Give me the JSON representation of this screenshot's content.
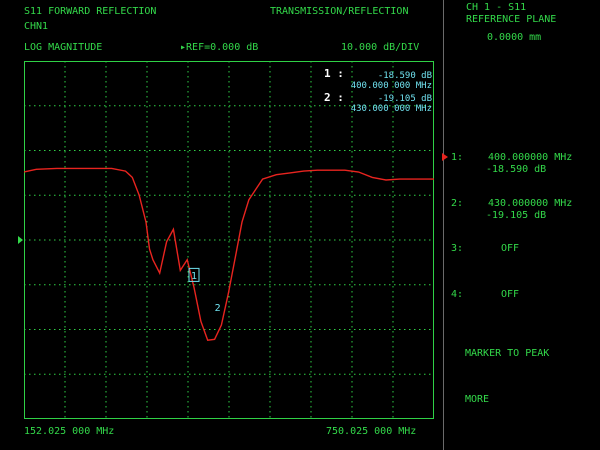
{
  "header": {
    "measurement": "S11 FORWARD REFLECTION",
    "mode": "TRANSMISSION/REFLECTION",
    "channel": "CHN1",
    "format": "LOG MAGNITUDE",
    "reference_marker": "▸",
    "reference": "REF=0.000 dB",
    "scale": "10.000 dB/DIV"
  },
  "footer": {
    "start_freq": "152.025 000 MHz",
    "stop_freq": "750.025 000 MHz"
  },
  "marker_readout": [
    {
      "num": "1 :",
      "value": "-18.590 dB",
      "freq": "400.000 000 MHz"
    },
    {
      "num": "2 :",
      "value": "-19.105 dB",
      "freq": "430.000 000 MHz"
    }
  ],
  "plot_markers": [
    {
      "label": "1",
      "active": true
    },
    {
      "label": "2",
      "active": false
    }
  ],
  "softkeys": {
    "title_line1": "CH 1 - S11",
    "title_line2": "REFERENCE PLANE",
    "title_line3": "0.0000 mm",
    "markers": [
      {
        "num": "1:",
        "freq": "400.000000 MHz",
        "value": "-18.590 dB"
      },
      {
        "num": "2:",
        "freq": "430.000000 MHz",
        "value": "-19.105 dB"
      },
      {
        "num": "3:",
        "state": "OFF"
      },
      {
        "num": "4:",
        "state": "OFF"
      }
    ],
    "marker_to_peak": "MARKER TO PEAK",
    "more": "MORE"
  },
  "colors": {
    "text": "#33d94a",
    "readout": "#6fe0ee",
    "grid": "#2fd146",
    "trace": "#e8241f",
    "active_arrow": "#e8241f"
  },
  "chart_data": {
    "type": "line",
    "title": "S11 FORWARD REFLECTION",
    "x_unit": "MHz",
    "y_unit": "dB",
    "xlim": [
      152.025,
      750.025
    ],
    "ylim": [
      -28,
      12
    ],
    "grid": true,
    "x_divisions": 10,
    "y_divisions": 8,
    "series": [
      {
        "x": [
          152.025,
          170,
          200,
          230,
          260,
          280,
          300,
          310,
          320,
          330,
          335,
          340,
          350,
          360,
          370,
          380,
          390,
          400,
          410,
          420,
          430,
          440,
          450,
          460,
          470,
          480,
          500,
          520,
          540,
          560,
          580,
          600,
          620,
          640,
          660,
          680,
          700,
          720,
          750.025
        ],
        "y": [
          -0.4,
          -0.1,
          0,
          0,
          0,
          0,
          -0.3,
          -1,
          -3,
          -6,
          -9,
          -10.2,
          -11.7,
          -8.2,
          -6.8,
          -11.4,
          -10.2,
          -13.3,
          -17.1,
          -19.2,
          -19.1,
          -17.5,
          -14,
          -10,
          -6,
          -3.5,
          -1.2,
          -0.7,
          -0.5,
          -0.3,
          -0.2,
          -0.2,
          -0.2,
          -0.4,
          -1,
          -1.3,
          -1.2,
          -1.2,
          -1.2
        ]
      }
    ]
  }
}
